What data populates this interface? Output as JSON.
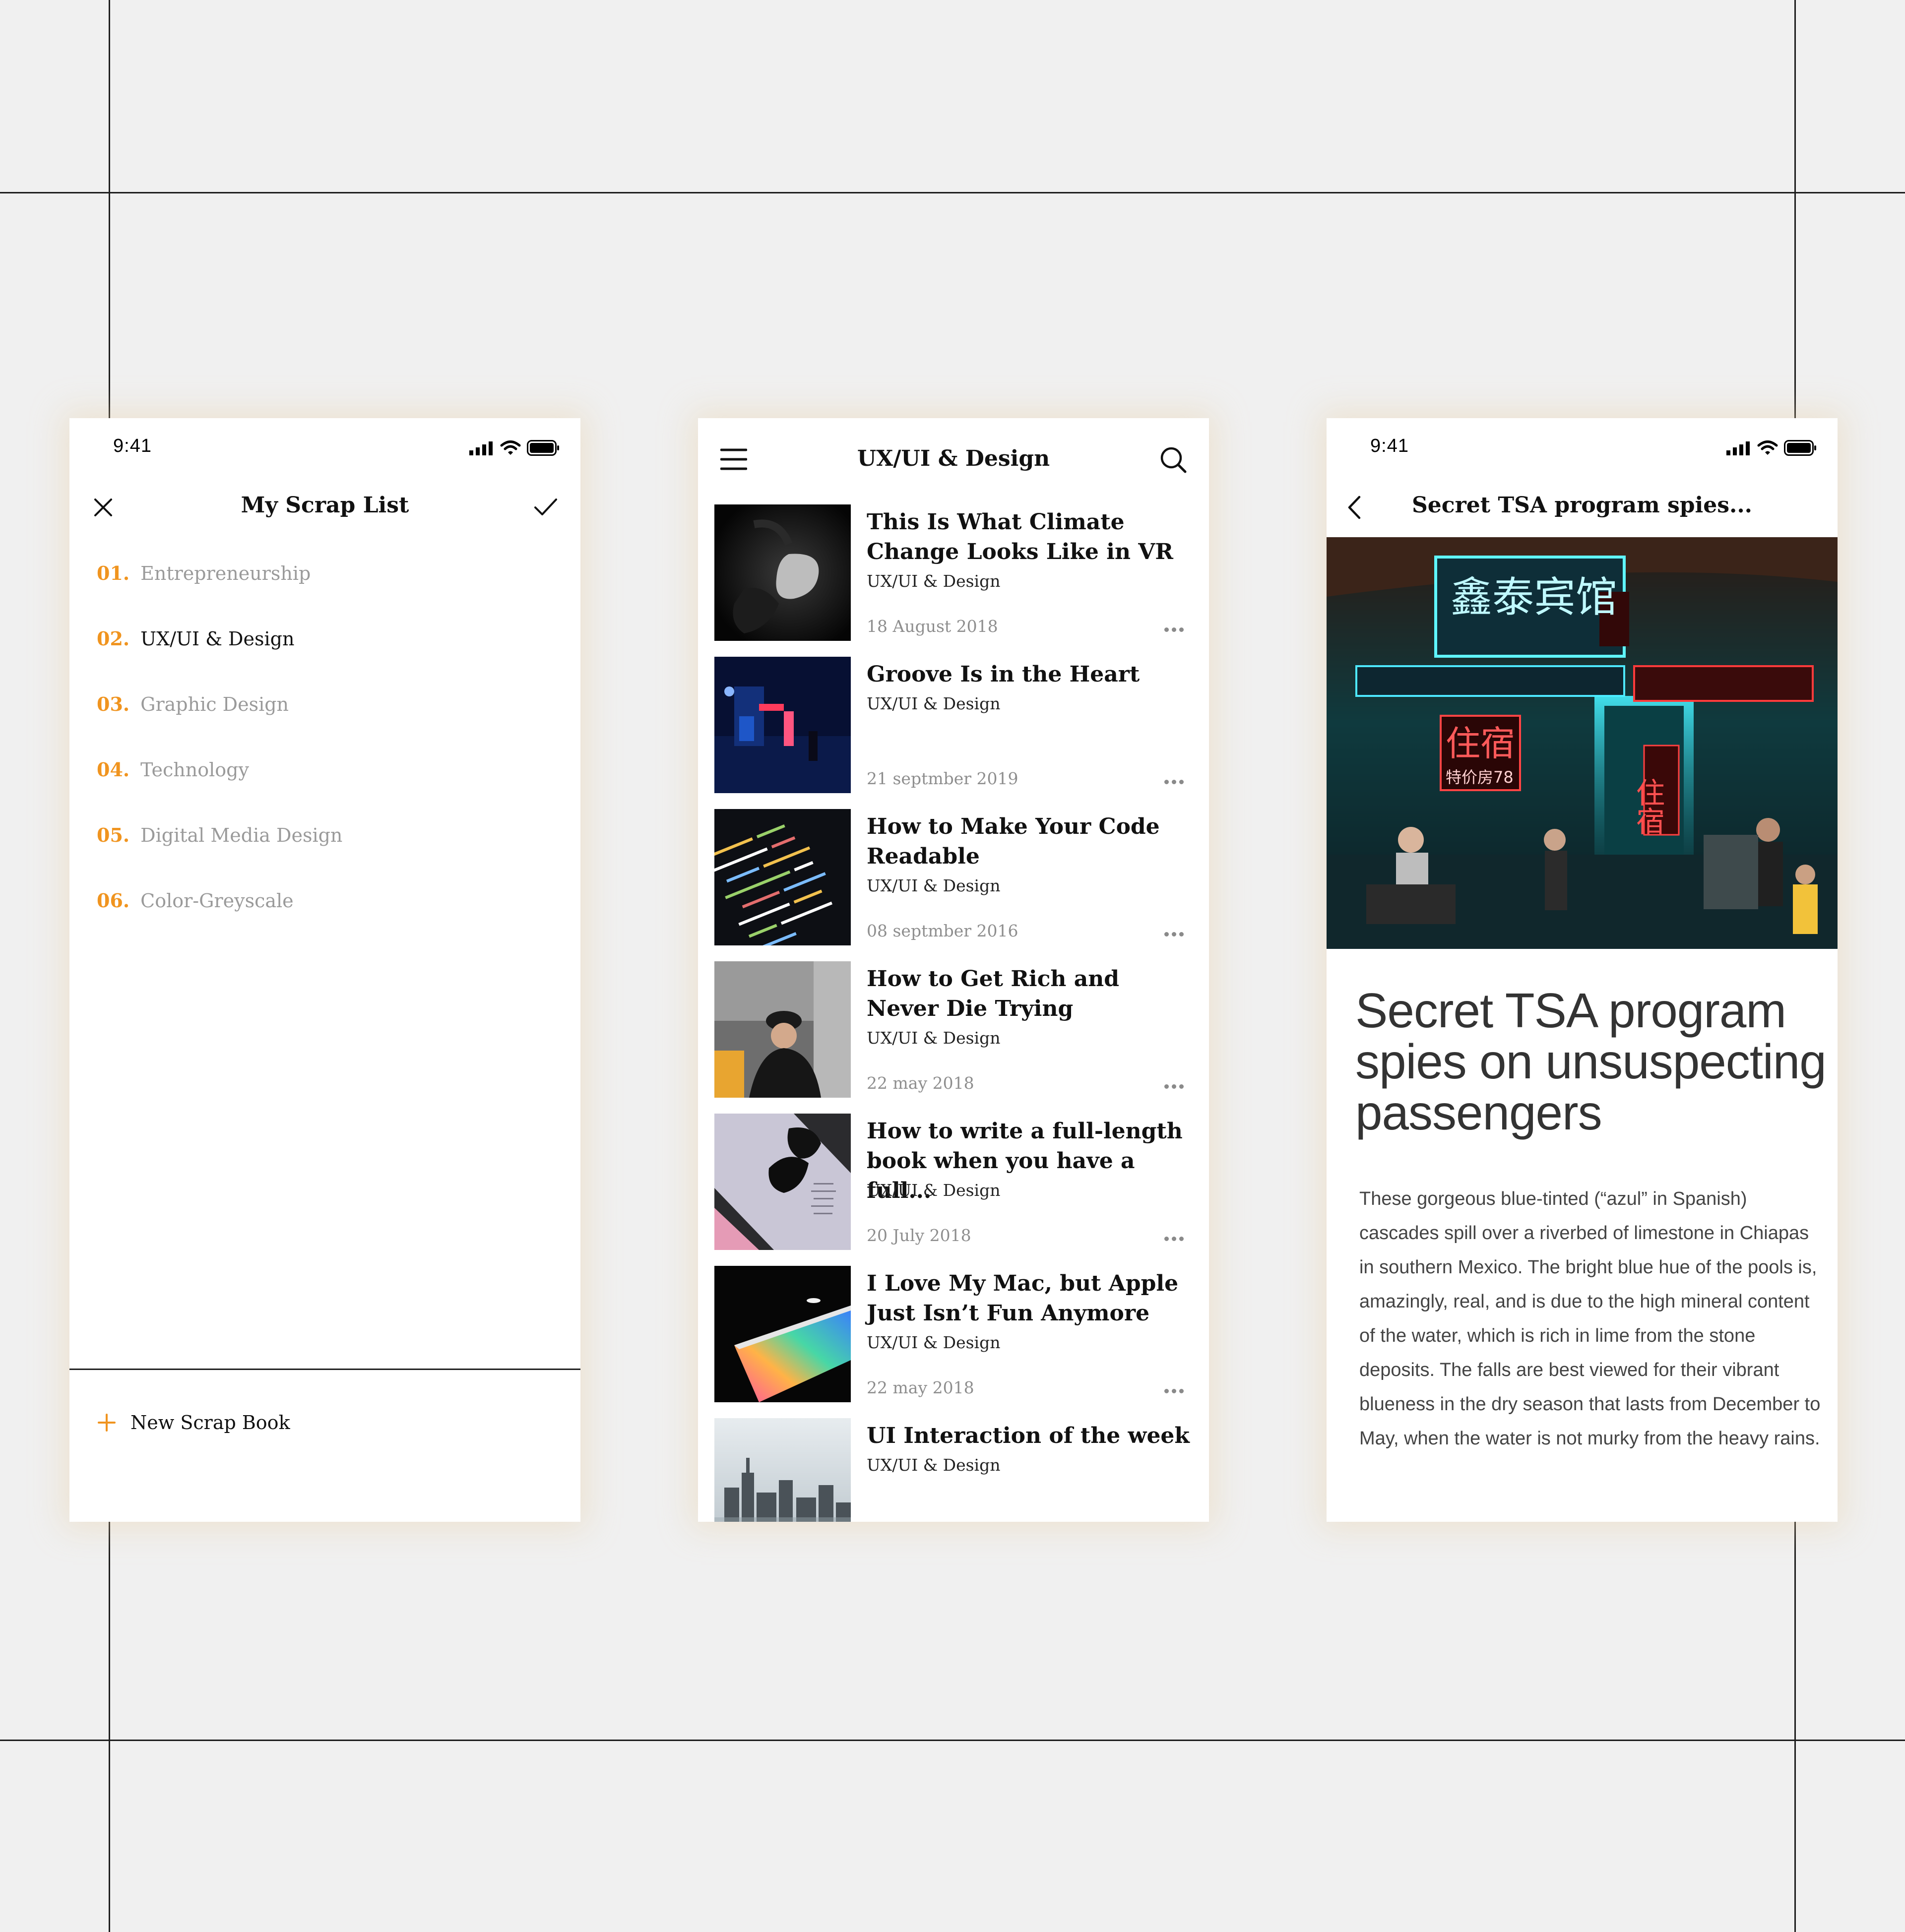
{
  "status_bar": {
    "time": "9:41"
  },
  "scrap_list": {
    "title": "My Scrap List",
    "categories": [
      {
        "number": "01.",
        "label": "Entrepreneurship",
        "active": false
      },
      {
        "number": "02.",
        "label": "UX/UI & Design",
        "active": true
      },
      {
        "number": "03.",
        "label": "Graphic Design",
        "active": false
      },
      {
        "number": "04.",
        "label": "Technology",
        "active": false
      },
      {
        "number": "05.",
        "label": "Digital Media Design",
        "active": false
      },
      {
        "number": "06.",
        "label": "Color-Greyscale",
        "active": false
      }
    ],
    "new_button_label": "New Scrap Book"
  },
  "feed": {
    "title": "UX/UI & Design",
    "articles": [
      {
        "title": "This Is What Climate Change Looks Like in VR",
        "category": "UX/UI & Design",
        "date": "18 August 2018"
      },
      {
        "title": "Groove Is in the Heart",
        "category": "UX/UI & Design",
        "date": "21 septmber 2019"
      },
      {
        "title": "How to Make Your Code Readable",
        "category": "UX/UI & Design",
        "date": "08 septmber 2016"
      },
      {
        "title": "How to Get Rich and Never Die Trying",
        "category": "UX/UI & Design",
        "date": "22 may 2018"
      },
      {
        "title": "How to write a full-length book when you have a full...",
        "category": "UX/UI & Design",
        "date": "20 July 2018"
      },
      {
        "title": "I Love My Mac, but Apple Just Isn’t Fun Anymore",
        "category": "UX/UI & Design",
        "date": "22 may 2018"
      },
      {
        "title": "UI Interaction of the week",
        "category": "UX/UI & Design",
        "date": ""
      }
    ]
  },
  "article_detail": {
    "nav_title": "Secret TSA program spies...",
    "headline": "Secret TSA program spies on unsuspecting passengers",
    "body": "These gorgeous blue-tinted (“azul” in Spanish) cascades spill over a riverbed of limestone in Chiapas in southern Mexico. The bright blue hue of the pools is, amazingly, real, and is due to the high mineral content of the water, which is rich in lime from the stone deposits. The falls are best viewed for their vibrant blueness in the dry season that lasts from December to May, when the water is not murky from the heavy rains.",
    "hero_signs": [
      "住宿",
      "特价房78",
      "鑫泰宾馆",
      "住宿"
    ]
  },
  "colors": {
    "accent": "#f0941f",
    "background": "#f0f0f0",
    "text": "#111111",
    "muted": "#9a9a9a"
  },
  "icons": {
    "close": "close-icon",
    "confirm": "check-icon",
    "add": "plus-icon",
    "menu": "hamburger-menu-icon",
    "search": "search-icon",
    "back": "chevron-left-icon",
    "more": "more-dots-icon"
  }
}
